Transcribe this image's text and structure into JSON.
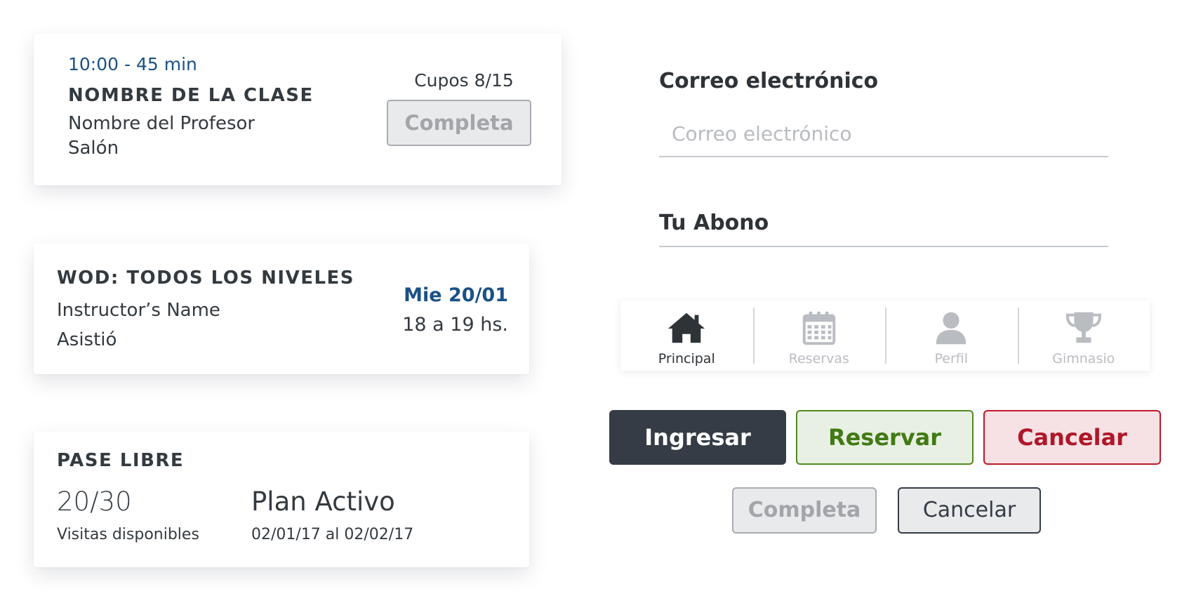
{
  "class_card": {
    "time": "10:00 - 45 min",
    "title": "NOMBRE DE LA CLASE",
    "teacher": "Nombre del Profesor",
    "room": "Salón",
    "spots": "Cupos 8/15",
    "status_button": "Completa"
  },
  "wod_card": {
    "title": "WOD: TODOS LOS NIVELES",
    "instructor": "Instructor’s Name",
    "attendance": "Asistió",
    "date": "Mie 20/01",
    "hours": "18 a 19 hs."
  },
  "pass_card": {
    "title": "PASE LIBRE",
    "visits": "20/30",
    "visits_label": "Visitas disponibles",
    "plan": "Plan Activo",
    "plan_dates": "02/01/17 al 02/02/17"
  },
  "email_field": {
    "label": "Correo electrónico",
    "placeholder": "Correo electrónico",
    "value": ""
  },
  "abono_field": {
    "label": "Tu Abono"
  },
  "tabbar": {
    "active_color": "#2e3338",
    "inactive_color": "#b9bcc1",
    "tabs": [
      {
        "label": "Principal",
        "icon": "home-icon",
        "active": true
      },
      {
        "label": "Reservas",
        "icon": "calendar-icon",
        "active": false
      },
      {
        "label": "Perfil",
        "icon": "user-icon",
        "active": false
      },
      {
        "label": "Gimnasio",
        "icon": "trophy-icon",
        "active": false
      }
    ]
  },
  "buttons": {
    "ingresar": "Ingresar",
    "reservar": "Reservar",
    "cancelar": "Cancelar",
    "completa": "Completa",
    "cancelar_secondary": "Cancelar"
  },
  "colors": {
    "accent_blue": "#1a5186",
    "dark": "#353c45",
    "success": "#4e8a20",
    "danger": "#c0172c"
  }
}
